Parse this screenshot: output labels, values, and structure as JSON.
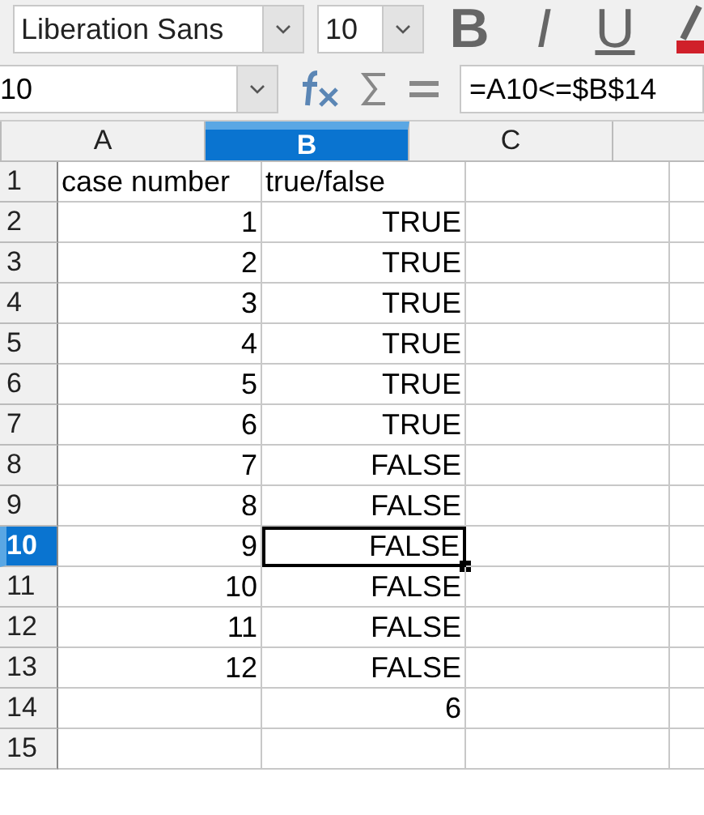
{
  "toolbar": {
    "font_name": "Liberation Sans",
    "font_size": "10",
    "bold": "B",
    "italic": "I",
    "underline": "U"
  },
  "formula_bar": {
    "name_box": "10",
    "formula": "=A10<=$B$14"
  },
  "columns": [
    {
      "label": "A",
      "selected": false
    },
    {
      "label": "B",
      "selected": true
    },
    {
      "label": "C",
      "selected": false
    }
  ],
  "rows": [
    {
      "number": "1",
      "selected": false,
      "cells": [
        {
          "text": "case number",
          "kind": "text",
          "selected": false
        },
        {
          "text": "true/false",
          "kind": "text",
          "selected": false
        },
        {
          "kind": "empty",
          "selected": false
        }
      ]
    },
    {
      "number": "2",
      "selected": false,
      "cells": [
        {
          "text": "1",
          "kind": "number",
          "selected": false
        },
        {
          "text": "TRUE",
          "kind": "boolean",
          "selected": false
        },
        {
          "kind": "empty",
          "selected": false
        }
      ]
    },
    {
      "number": "3",
      "selected": false,
      "cells": [
        {
          "text": "2",
          "kind": "number",
          "selected": false
        },
        {
          "text": "TRUE",
          "kind": "boolean",
          "selected": false
        },
        {
          "kind": "empty",
          "selected": false
        }
      ]
    },
    {
      "number": "4",
      "selected": false,
      "cells": [
        {
          "text": "3",
          "kind": "number",
          "selected": false
        },
        {
          "text": "TRUE",
          "kind": "boolean",
          "selected": false
        },
        {
          "kind": "empty",
          "selected": false
        }
      ]
    },
    {
      "number": "5",
      "selected": false,
      "cells": [
        {
          "text": "4",
          "kind": "number",
          "selected": false
        },
        {
          "text": "TRUE",
          "kind": "boolean",
          "selected": false
        },
        {
          "kind": "empty",
          "selected": false
        }
      ]
    },
    {
      "number": "6",
      "selected": false,
      "cells": [
        {
          "text": "5",
          "kind": "number",
          "selected": false
        },
        {
          "text": "TRUE",
          "kind": "boolean",
          "selected": false
        },
        {
          "kind": "empty",
          "selected": false
        }
      ]
    },
    {
      "number": "7",
      "selected": false,
      "cells": [
        {
          "text": "6",
          "kind": "number",
          "selected": false
        },
        {
          "text": "TRUE",
          "kind": "boolean",
          "selected": false
        },
        {
          "kind": "empty",
          "selected": false
        }
      ]
    },
    {
      "number": "8",
      "selected": false,
      "cells": [
        {
          "text": "7",
          "kind": "number",
          "selected": false
        },
        {
          "text": "FALSE",
          "kind": "boolean",
          "selected": false
        },
        {
          "kind": "empty",
          "selected": false
        }
      ]
    },
    {
      "number": "9",
      "selected": false,
      "cells": [
        {
          "text": "8",
          "kind": "number",
          "selected": false
        },
        {
          "text": "FALSE",
          "kind": "boolean",
          "selected": false
        },
        {
          "kind": "empty",
          "selected": false
        }
      ]
    },
    {
      "number": "10",
      "selected": true,
      "cells": [
        {
          "text": "9",
          "kind": "number",
          "selected": false
        },
        {
          "text": "FALSE",
          "kind": "boolean",
          "selected": true
        },
        {
          "kind": "empty",
          "selected": false
        }
      ]
    },
    {
      "number": "11",
      "selected": false,
      "cells": [
        {
          "text": "10",
          "kind": "number",
          "selected": false
        },
        {
          "text": "FALSE",
          "kind": "boolean",
          "selected": false
        },
        {
          "kind": "empty",
          "selected": false
        }
      ]
    },
    {
      "number": "12",
      "selected": false,
      "cells": [
        {
          "text": "11",
          "kind": "number",
          "selected": false
        },
        {
          "text": "FALSE",
          "kind": "boolean",
          "selected": false
        },
        {
          "kind": "empty",
          "selected": false
        }
      ]
    },
    {
      "number": "13",
      "selected": false,
      "cells": [
        {
          "text": "12",
          "kind": "number",
          "selected": false
        },
        {
          "text": "FALSE",
          "kind": "boolean",
          "selected": false
        },
        {
          "kind": "empty",
          "selected": false
        }
      ]
    },
    {
      "number": "14",
      "selected": false,
      "cells": [
        {
          "kind": "empty",
          "selected": false
        },
        {
          "text": "6",
          "kind": "number",
          "selected": false
        },
        {
          "kind": "empty",
          "selected": false
        }
      ]
    },
    {
      "number": "15",
      "selected": false,
      "cells": [
        {
          "kind": "empty",
          "selected": false
        },
        {
          "kind": "empty",
          "selected": false
        },
        {
          "kind": "empty",
          "selected": false
        }
      ]
    }
  ]
}
